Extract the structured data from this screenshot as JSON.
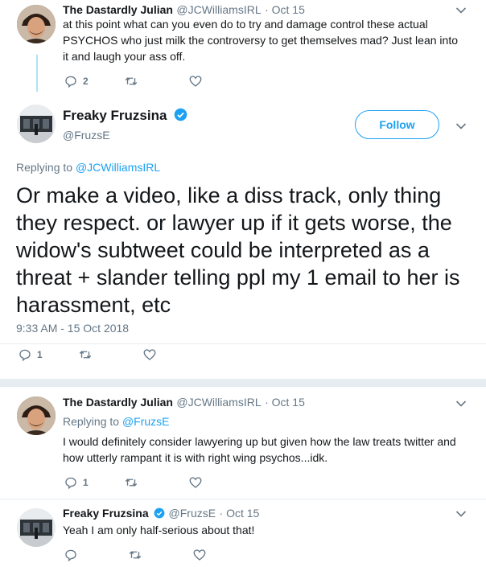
{
  "tweet1": {
    "name": "The Dastardly Julian",
    "handle": "@JCWilliamsIRL",
    "date": "· Oct 15",
    "text": "at this point what can you even do to try and damage control these actual PSYCHOS who just milk the controversy to get themselves mad? Just lean into it and laugh your ass off.",
    "reply_count": "2"
  },
  "main": {
    "name": "Freaky Fruzsina",
    "handle": "@FruzsE",
    "follow_label": "Follow",
    "replying_prefix": "Replying to",
    "replying_handle": "@JCWilliamsIRL",
    "text": "Or make a video, like a diss track, only thing they respect. or lawyer up if it gets worse, the widow's subtweet could be interpreted as a threat + slander telling ppl my 1 email to her is harassment, etc",
    "timestamp": "9:33 AM - 15 Oct 2018",
    "reply_count": "1"
  },
  "reply1": {
    "name": "The Dastardly Julian",
    "handle": "@JCWilliamsIRL",
    "date": "· Oct 15",
    "replying_prefix": "Replying to",
    "replying_handle": "@FruzsE",
    "text": "I would definitely consider lawyering up but given how the law treats twitter and how utterly rampant it is with right wing psychos...idk.",
    "reply_count": "1"
  },
  "reply2": {
    "name": "Freaky Fruzsina",
    "handle": "@FruzsE",
    "date": "· Oct 15",
    "text": "Yeah I am only half-serious about that!"
  },
  "colors": {
    "accent": "#1da1f2",
    "muted": "#657786",
    "thread_line": "#b1e2f7",
    "divider": "#e6ecf0"
  }
}
